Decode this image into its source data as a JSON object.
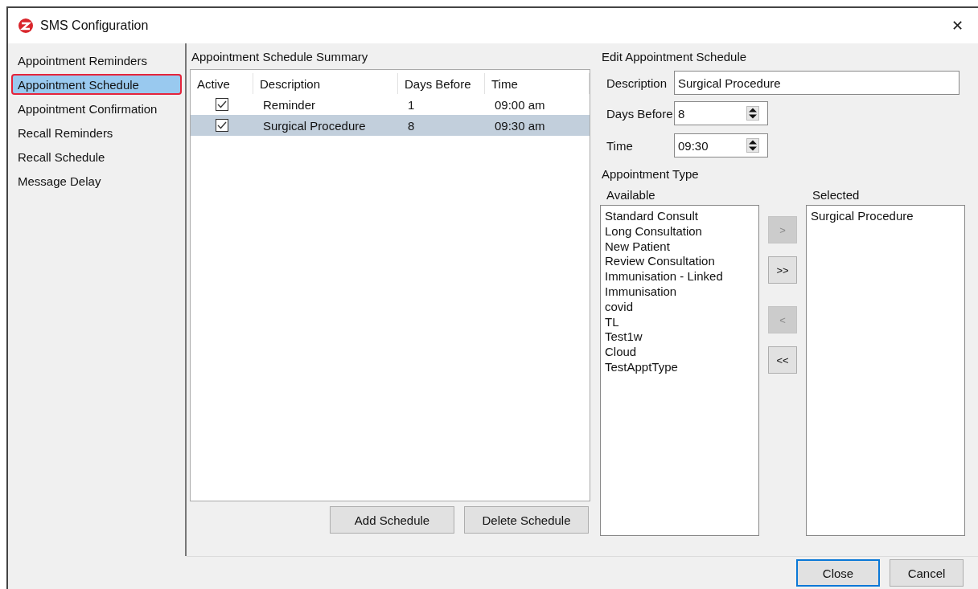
{
  "window": {
    "title": "SMS Configuration",
    "close": "✕"
  },
  "sidebar": {
    "items": [
      {
        "label": "Appointment Reminders",
        "selected": false,
        "highlighted": false
      },
      {
        "label": "Appointment Schedule",
        "selected": true,
        "highlighted": true
      },
      {
        "label": "Appointment Confirmation",
        "selected": false,
        "highlighted": false
      },
      {
        "label": "Recall Reminders",
        "selected": false,
        "highlighted": false
      },
      {
        "label": "Recall Schedule",
        "selected": false,
        "highlighted": false
      },
      {
        "label": "Message Delay",
        "selected": false,
        "highlighted": false
      }
    ]
  },
  "summary": {
    "title": "Appointment Schedule Summary",
    "columns": [
      "Active",
      "Description",
      "Days Before",
      "Time"
    ],
    "rows": [
      {
        "active": true,
        "selected": false,
        "description": "Reminder",
        "days_before": "1",
        "time": "09:00 am"
      },
      {
        "active": true,
        "selected": true,
        "description": "Surgical Procedure",
        "days_before": "8",
        "time": "09:30 am"
      }
    ],
    "buttons": [
      "Add Schedule",
      "Delete Schedule"
    ]
  },
  "edit": {
    "title": "Edit Appointment Schedule",
    "description_label": "Description",
    "description_value": "Surgical Procedure",
    "days_label": "Days Before",
    "days_value": "8",
    "time_label": "Time",
    "time_value": "09:30",
    "type_title": "Appointment Type",
    "available_label": "Available",
    "selected_label": "Selected",
    "available": [
      "Standard Consult",
      "Long Consultation",
      "New Patient",
      "Review Consultation",
      "Immunisation - Linked",
      "Immunisation",
      "covid",
      "TL",
      "Test1w",
      "Cloud",
      "TestApptType"
    ],
    "selected": [
      "Surgical Procedure"
    ],
    "move_buttons": [
      {
        "label": ">",
        "disabled": true
      },
      {
        "label": ">>",
        "disabled": false
      },
      {
        "label": "<",
        "disabled": true
      },
      {
        "label": "<<",
        "disabled": false
      }
    ]
  },
  "footer": {
    "buttons": [
      {
        "label": "Close",
        "default": true
      },
      {
        "label": "Cancel",
        "default": false
      }
    ]
  }
}
